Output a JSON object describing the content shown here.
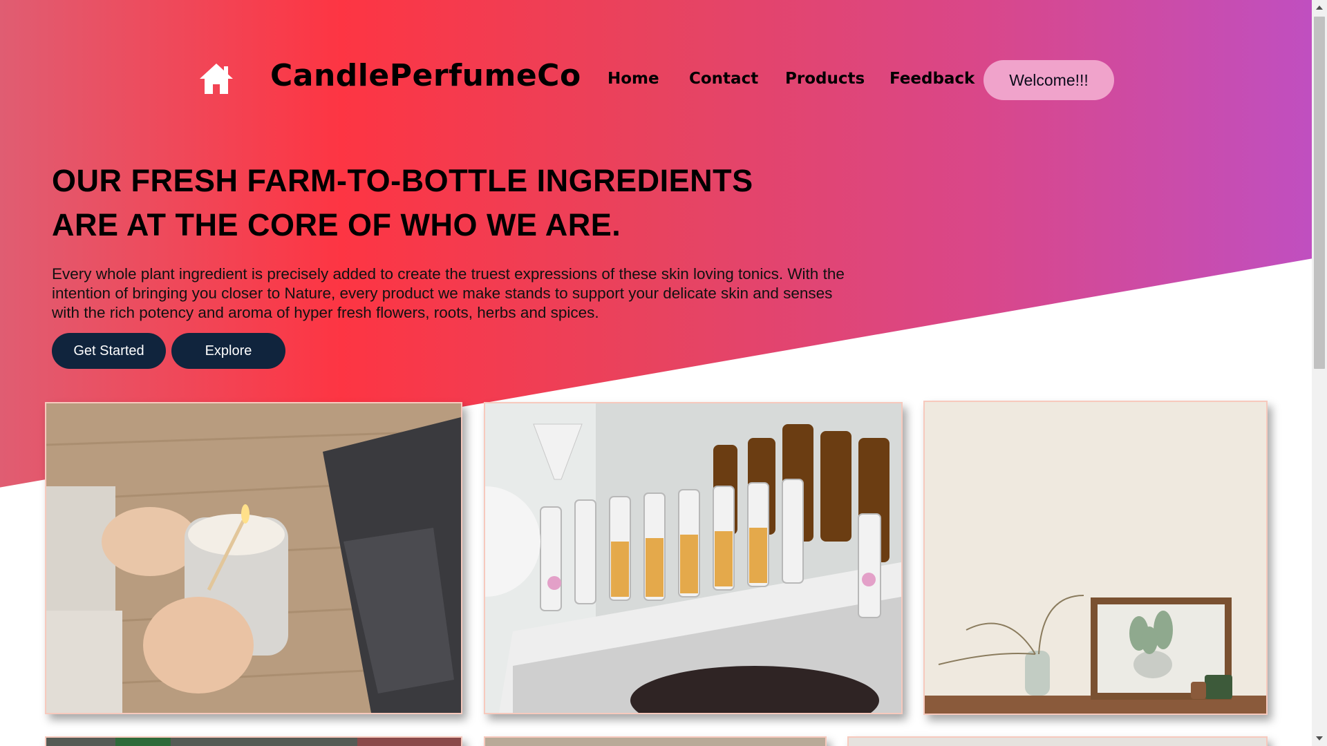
{
  "nav": {
    "brand": "CandlePerfumeCo",
    "home_icon": "house-icon",
    "links": [
      "Home",
      "Contact",
      "Products",
      "Feedback"
    ],
    "welcome": "Welcome!!!"
  },
  "hero": {
    "headline_line1": "OUR FRESH FARM-TO-BOTTLE INGREDIENTS",
    "headline_line2": "ARE AT THE CORE OF WHO WE ARE.",
    "intro": "Every whole plant ingredient is precisely added to create the truest expressions of these skin loving tonics. With the intention of bringing you closer to Nature, every product we make stands to support your delicate skin and senses with the rich potency and aroma of hyper fresh flowers, roots, herbs and spices.",
    "buttons": [
      "Get Started",
      "Explore"
    ]
  },
  "colors": {
    "gradient_start": "#e05d72",
    "gradient_mid": "#fd3543",
    "gradient_end": "#c04fc0",
    "button_dark": "#10243d",
    "welcome_bg": "#f0a3cb",
    "card_border": "#f7c9bd"
  }
}
